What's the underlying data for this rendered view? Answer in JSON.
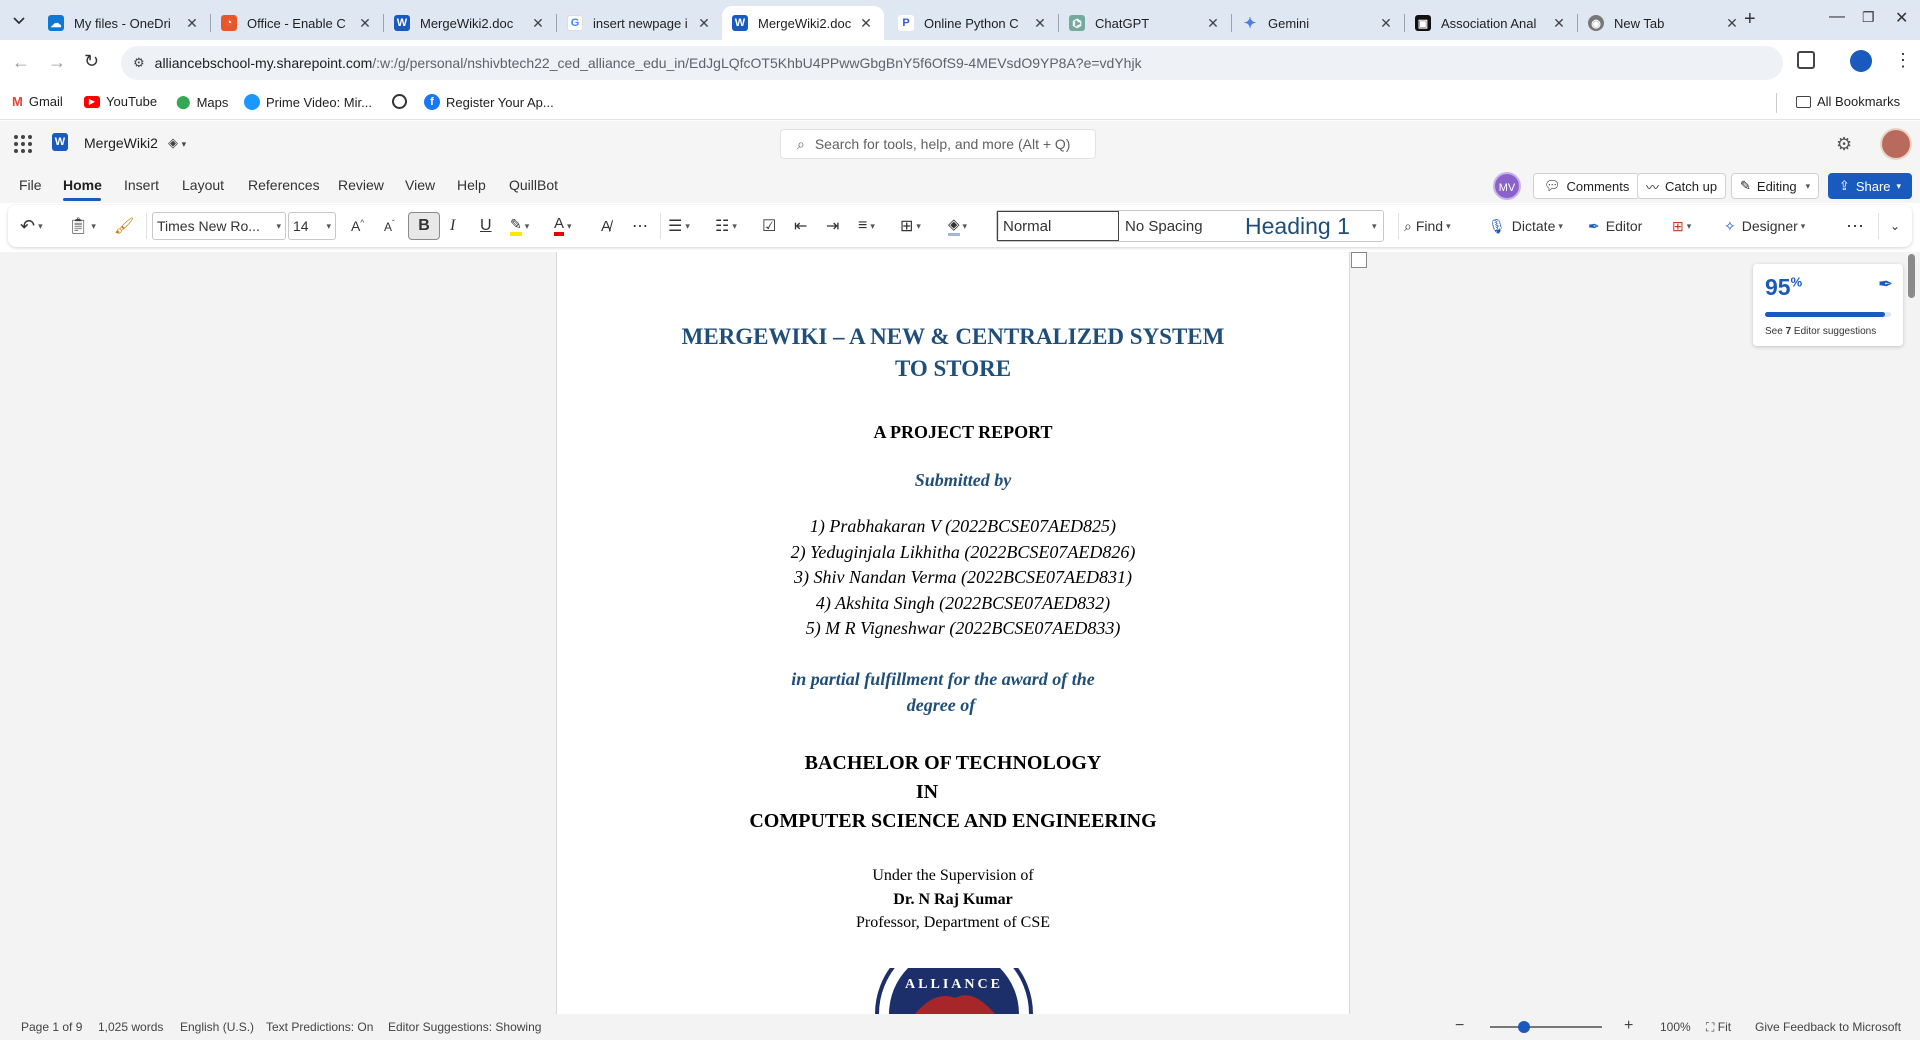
{
  "browser": {
    "tabs": [
      {
        "title": "My files - OneDri",
        "icon": "onedrive-icon"
      },
      {
        "title": "Office - Enable C",
        "icon": "office-icon"
      },
      {
        "title": "MergeWiki2.doc",
        "icon": "word-icon"
      },
      {
        "title": "insert newpage i",
        "icon": "google-icon"
      },
      {
        "title": "MergeWiki2.doc",
        "icon": "word-icon",
        "active": true
      },
      {
        "title": "Online Python C",
        "icon": "python-icon"
      },
      {
        "title": "ChatGPT",
        "icon": "chatgpt-icon"
      },
      {
        "title": "Gemini",
        "icon": "gemini-icon"
      },
      {
        "title": "Association Anal",
        "icon": "video-icon"
      },
      {
        "title": "New Tab",
        "icon": "chrome-icon"
      }
    ],
    "url_host": "alliancebschool-my.sharepoint.com",
    "url_path": "/:w:/g/personal/nshivbtech22_ced_alliance_edu_in/EdJgLQfcOT5KhbU4PPwwGbgBnY5f6OfS9-4MEVsdO9YP8A?e=vdYhjk",
    "bookmarks": [
      "Gmail",
      "YouTube",
      "Maps",
      "Prime Video: Mir...",
      "",
      "Register Your Ap..."
    ],
    "all_bookmarks": "All Bookmarks"
  },
  "word": {
    "doc_name": "MergeWiki2",
    "search_placeholder": "Search for tools, help, and more (Alt + Q)",
    "avatar_initials": "MV",
    "comments": "Comments",
    "catch_up": "Catch up",
    "editing": "Editing",
    "share": "Share",
    "menu": [
      "File",
      "Home",
      "Insert",
      "Layout",
      "References",
      "Review",
      "View",
      "Help",
      "QuillBot"
    ],
    "font_name": "Times New Ro...",
    "font_size": "14",
    "styles": [
      "Normal",
      "No Spacing",
      "Heading 1"
    ],
    "find": "Find",
    "dictate": "Dictate",
    "editor": "Editor",
    "designer": "Designer"
  },
  "editor_card": {
    "score": "95",
    "score_unit": "%",
    "score_fraction": 0.95,
    "see": "See",
    "count": "7",
    "suffix": "Editor suggestions"
  },
  "document": {
    "title_1": "MERGEWIKI – A NEW & CENTRALIZED SYSTEM",
    "title_2": "TO STORE",
    "report": "A PROJECT REPORT",
    "submitted_by": "Submitted by",
    "members": [
      "1)  Prabhakaran V (2022BCSE07AED825)",
      "2)  Yeduginjala Likhitha (2022BCSE07AED826)",
      "3)  Shiv Nandan Verma (2022BCSE07AED831)",
      "4)  Akshita Singh (2022BCSE07AED832)",
      "5)  M R Vigneshwar (2022BCSE07AED833)"
    ],
    "partial_1": "in partial fulfillment for the award of the",
    "partial_2": "degree of",
    "degree_1": "BACHELOR OF TECHNOLOGY",
    "degree_2": "IN",
    "degree_3": "COMPUTER SCIENCE AND ENGINEERING",
    "supervision": "Under the Supervision of",
    "supervisor": "Dr. N Raj Kumar",
    "designation": "Professor, Department of CSE",
    "logo_text": "ALLIANCE"
  },
  "status": {
    "page": "Page 1 of 9",
    "words": "1,025 words",
    "language": "English (U.S.)",
    "predictions": "Text Predictions: On",
    "suggestions": "Editor Suggestions: Showing",
    "zoom": "100%",
    "zoom_fraction": 0.3,
    "fit": "Fit",
    "feedback": "Give Feedback to Microsoft"
  },
  "colors": {
    "accent": "#185abd",
    "heading_blue": "#1f4e79",
    "tab_strip": "#dfe7f3"
  }
}
